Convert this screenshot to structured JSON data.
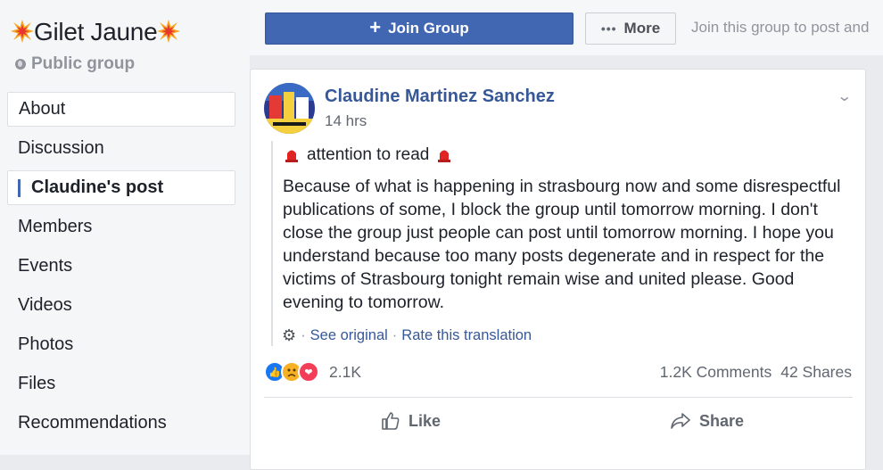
{
  "sidebar": {
    "group_name": "Gilet Jaune",
    "group_type": "Public group",
    "items": [
      {
        "label": "About"
      },
      {
        "label": "Discussion"
      },
      {
        "label": "Claudine's post"
      },
      {
        "label": "Members"
      },
      {
        "label": "Events"
      },
      {
        "label": "Videos"
      },
      {
        "label": "Photos"
      },
      {
        "label": "Files"
      },
      {
        "label": "Recommendations"
      }
    ]
  },
  "topbar": {
    "join_label": "Join Group",
    "more_label": "More",
    "hint": "Join this group to post and"
  },
  "post": {
    "author": "Claudine Martinez Sanchez",
    "time": "14 hrs",
    "attention": "attention to read",
    "body": "Because of what is happening in strasbourg now and some disrespectful publications of some, I block the group until tomorrow morning. I don't close the group just people can post until tomorrow morning. I hope you understand because too many posts degenerate and in respect for the victims of Strasbourg tonight remain wise and united please. Good evening to tomorrow.",
    "see_original": "See original",
    "rate_translation": "Rate this translation",
    "reaction_count": "2.1K",
    "comments": "1.2K Comments",
    "shares": "42 Shares",
    "like_label": "Like",
    "share_label": "Share"
  },
  "colors": {
    "accent": "#4267b2",
    "link": "#365899",
    "page_bg": "#e9ebee"
  }
}
